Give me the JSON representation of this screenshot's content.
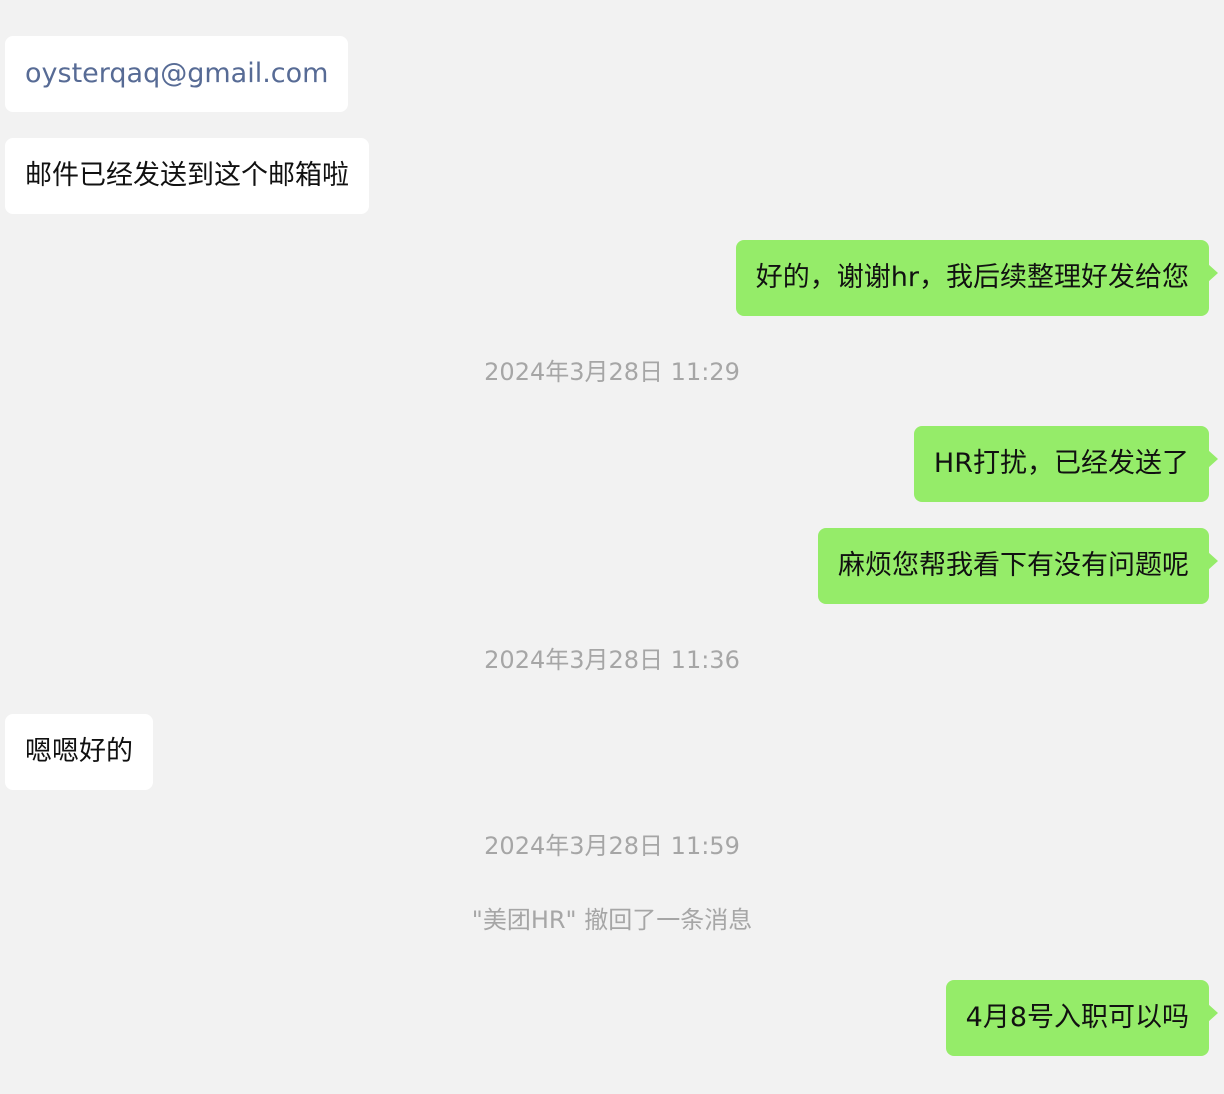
{
  "messages": [
    {
      "type": "incoming",
      "text": "oysterqaq@gmail.com",
      "is_link": true
    },
    {
      "type": "incoming",
      "text": "邮件已经发送到这个邮箱啦"
    },
    {
      "type": "outgoing",
      "text": "好的，谢谢hr，我后续整理好发给您"
    },
    {
      "type": "timestamp",
      "text": "2024年3月28日 11:29"
    },
    {
      "type": "outgoing",
      "text": "HR打扰，已经发送了"
    },
    {
      "type": "outgoing",
      "text": "麻烦您帮我看下有没有问题呢"
    },
    {
      "type": "timestamp",
      "text": "2024年3月28日 11:36"
    },
    {
      "type": "incoming",
      "text": "嗯嗯好的"
    },
    {
      "type": "timestamp",
      "text": "2024年3月28日 11:59"
    },
    {
      "type": "system",
      "text": "\"美团HR\" 撤回了一条消息"
    },
    {
      "type": "outgoing",
      "text": "4月8号入职可以吗"
    }
  ],
  "colors": {
    "background": "#f2f2f2",
    "incoming_bubble": "#ffffff",
    "outgoing_bubble": "#95ec69",
    "link_text": "#576b95",
    "system_text": "#a6a6a6"
  }
}
